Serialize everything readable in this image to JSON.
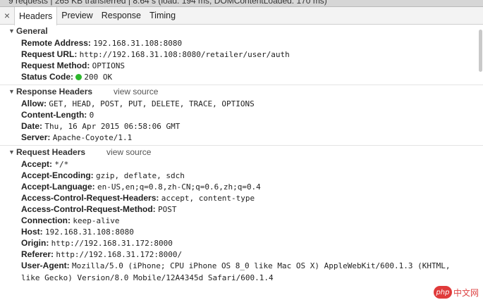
{
  "status_bar": {
    "summary": "9 requests | 265 KB transferred | 8.64 s (load: 194 ms, DOMContentLoaded: 170 ms)"
  },
  "tabs": {
    "close_glyph": "×",
    "items": [
      {
        "label": "Headers",
        "active": true
      },
      {
        "label": "Preview",
        "active": false
      },
      {
        "label": "Response",
        "active": false
      },
      {
        "label": "Timing",
        "active": false
      }
    ]
  },
  "general": {
    "title": "General",
    "remote_address": {
      "key": "Remote Address:",
      "value": "192.168.31.108:8080"
    },
    "request_url": {
      "key": "Request URL:",
      "value": "http://192.168.31.108:8080/retailer/user/auth"
    },
    "request_method": {
      "key": "Request Method:",
      "value": "OPTIONS"
    },
    "status_code": {
      "key": "Status Code:",
      "value": "200 OK",
      "dot_color": "#2db82d"
    }
  },
  "response_headers": {
    "title": "Response Headers",
    "view_source": "view source",
    "allow": {
      "key": "Allow:",
      "value": "GET, HEAD, POST, PUT, DELETE, TRACE, OPTIONS"
    },
    "content_length": {
      "key": "Content-Length:",
      "value": "0"
    },
    "date": {
      "key": "Date:",
      "value": "Thu, 16 Apr 2015 06:58:06 GMT"
    },
    "server": {
      "key": "Server:",
      "value": "Apache-Coyote/1.1"
    }
  },
  "request_headers": {
    "title": "Request Headers",
    "view_source": "view source",
    "accept": {
      "key": "Accept:",
      "value": "*/*"
    },
    "accept_encoding": {
      "key": "Accept-Encoding:",
      "value": "gzip, deflate, sdch"
    },
    "accept_language": {
      "key": "Accept-Language:",
      "value": "en-US,en;q=0.8,zh-CN;q=0.6,zh;q=0.4"
    },
    "acr_headers": {
      "key": "Access-Control-Request-Headers:",
      "value": "accept, content-type"
    },
    "acr_method": {
      "key": "Access-Control-Request-Method:",
      "value": "POST"
    },
    "connection": {
      "key": "Connection:",
      "value": "keep-alive"
    },
    "host": {
      "key": "Host:",
      "value": "192.168.31.108:8080"
    },
    "origin": {
      "key": "Origin:",
      "value": "http://192.168.31.172:8000"
    },
    "referer": {
      "key": "Referer:",
      "value": "http://192.168.31.172:8000/"
    },
    "user_agent": {
      "key": "User-Agent:",
      "value": "Mozilla/5.0 (iPhone; CPU iPhone OS 8_0 like Mac OS X) AppleWebKit/600.1.3 (KHTML, like Gecko) Version/8.0 Mobile/12A4345d Safari/600.1.4"
    }
  },
  "watermark": {
    "logo": "php",
    "text": "中文网"
  }
}
